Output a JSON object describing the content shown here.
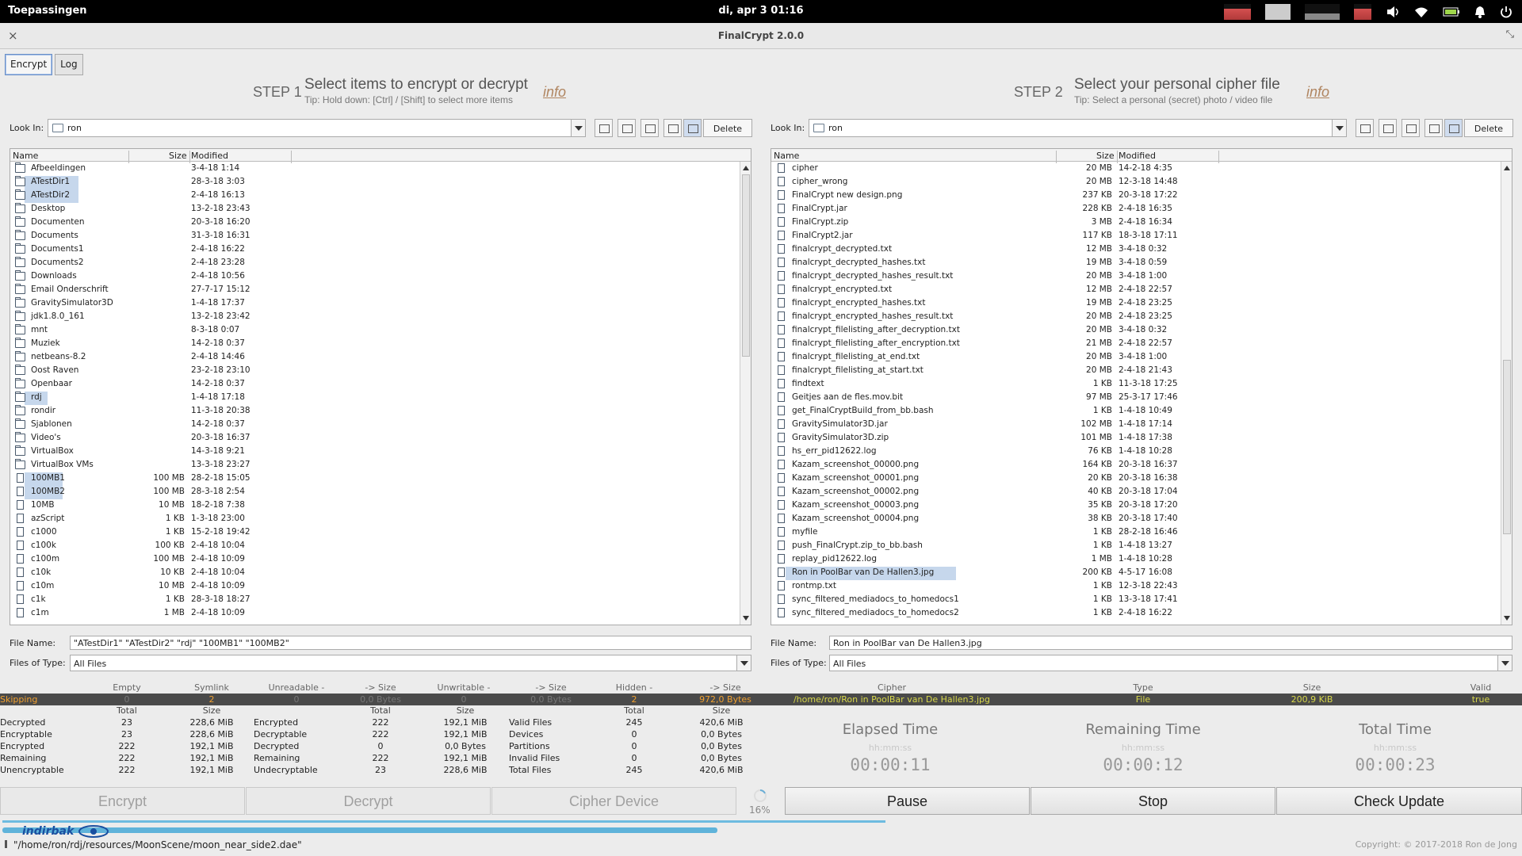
{
  "system_bar": {
    "apps_label": "Toepassingen",
    "clock": "di, apr  3    01:16"
  },
  "window": {
    "title": "FinalCrypt 2.0.0"
  },
  "tabs": [
    {
      "label": "Encrypt",
      "active": true
    },
    {
      "label": "Log",
      "active": false
    }
  ],
  "step1": {
    "num": "STEP 1",
    "heading": "Select items to encrypt or decrypt",
    "tip": "Tip: Hold down: [Ctrl] / [Shift] to select more items",
    "info": "info",
    "look_in_label": "Look In:",
    "look_in_value": "ron",
    "delete_label": "Delete",
    "columns": [
      "Name",
      "Size",
      "Modified"
    ],
    "rows": [
      {
        "name": "Afbeeldingen",
        "size": "",
        "modified": "3-4-18 1:14",
        "type": "folder",
        "selected": false
      },
      {
        "name": "ATestDir1",
        "size": "",
        "modified": "28-3-18 3:03",
        "type": "folder",
        "selected": true
      },
      {
        "name": "ATestDir2",
        "size": "",
        "modified": "2-4-18 16:13",
        "type": "folder",
        "selected": true
      },
      {
        "name": "Desktop",
        "size": "",
        "modified": "13-2-18 23:43",
        "type": "folder",
        "selected": false
      },
      {
        "name": "Documenten",
        "size": "",
        "modified": "20-3-18 16:20",
        "type": "folder",
        "selected": false
      },
      {
        "name": "Documents",
        "size": "",
        "modified": "31-3-18 16:31",
        "type": "folder",
        "selected": false
      },
      {
        "name": "Documents1",
        "size": "",
        "modified": "2-4-18 16:22",
        "type": "folder",
        "selected": false
      },
      {
        "name": "Documents2",
        "size": "",
        "modified": "2-4-18 23:28",
        "type": "folder",
        "selected": false
      },
      {
        "name": "Downloads",
        "size": "",
        "modified": "2-4-18 10:56",
        "type": "folder",
        "selected": false
      },
      {
        "name": "Email Onderschrift",
        "size": "",
        "modified": "27-7-17 15:12",
        "type": "folder",
        "selected": false
      },
      {
        "name": "GravitySimulator3D",
        "size": "",
        "modified": "1-4-18 17:37",
        "type": "folder",
        "selected": false
      },
      {
        "name": "jdk1.8.0_161",
        "size": "",
        "modified": "13-2-18 23:42",
        "type": "folder",
        "selected": false
      },
      {
        "name": "mnt",
        "size": "",
        "modified": "8-3-18 0:07",
        "type": "folder",
        "selected": false
      },
      {
        "name": "Muziek",
        "size": "",
        "modified": "14-2-18 0:37",
        "type": "folder",
        "selected": false
      },
      {
        "name": "netbeans-8.2",
        "size": "",
        "modified": "2-4-18 14:46",
        "type": "folder",
        "selected": false
      },
      {
        "name": "Oost Raven",
        "size": "",
        "modified": "23-2-18 23:10",
        "type": "folder",
        "selected": false
      },
      {
        "name": "Openbaar",
        "size": "",
        "modified": "14-2-18 0:37",
        "type": "folder",
        "selected": false
      },
      {
        "name": "rdj",
        "size": "",
        "modified": "1-4-18 17:18",
        "type": "folder",
        "selected": true
      },
      {
        "name": "rondir",
        "size": "",
        "modified": "11-3-18 20:38",
        "type": "folder",
        "selected": false
      },
      {
        "name": "Sjablonen",
        "size": "",
        "modified": "14-2-18 0:37",
        "type": "folder",
        "selected": false
      },
      {
        "name": "Video's",
        "size": "",
        "modified": "20-3-18 16:37",
        "type": "folder",
        "selected": false
      },
      {
        "name": "VirtualBox",
        "size": "",
        "modified": "14-3-18 9:21",
        "type": "folder",
        "selected": false
      },
      {
        "name": "VirtualBox VMs",
        "size": "",
        "modified": "13-3-18 23:27",
        "type": "folder",
        "selected": false
      },
      {
        "name": "100MB1",
        "size": "100 MB",
        "modified": "28-2-18 15:05",
        "type": "file",
        "selected": true
      },
      {
        "name": "100MB2",
        "size": "100 MB",
        "modified": "28-3-18 2:54",
        "type": "file",
        "selected": true
      },
      {
        "name": "10MB",
        "size": "10 MB",
        "modified": "18-2-18 7:38",
        "type": "file",
        "selected": false
      },
      {
        "name": "azScript",
        "size": "1 KB",
        "modified": "1-3-18 23:00",
        "type": "file",
        "selected": false
      },
      {
        "name": "c1000",
        "size": "1 KB",
        "modified": "15-2-18 19:42",
        "type": "file",
        "selected": false
      },
      {
        "name": "c100k",
        "size": "100 KB",
        "modified": "2-4-18 10:04",
        "type": "file",
        "selected": false
      },
      {
        "name": "c100m",
        "size": "100 MB",
        "modified": "2-4-18 10:09",
        "type": "file",
        "selected": false
      },
      {
        "name": "c10k",
        "size": "10 KB",
        "modified": "2-4-18 10:04",
        "type": "file",
        "selected": false
      },
      {
        "name": "c10m",
        "size": "10 MB",
        "modified": "2-4-18 10:09",
        "type": "file",
        "selected": false
      },
      {
        "name": "c1k",
        "size": "1 KB",
        "modified": "28-3-18 18:27",
        "type": "file",
        "selected": false
      },
      {
        "name": "c1m",
        "size": "1 MB",
        "modified": "2-4-18 10:09",
        "type": "file",
        "selected": false
      }
    ],
    "file_name_label": "File Name:",
    "file_name_value": "\"ATestDir1\" \"ATestDir2\" \"rdj\" \"100MB1\" \"100MB2\"",
    "files_of_type_label": "Files of Type:",
    "files_of_type_value": "All Files"
  },
  "step2": {
    "num": "STEP 2",
    "heading": "Select your personal cipher file",
    "tip": "Tip: Select a personal (secret) photo / video file",
    "info": "info",
    "look_in_label": "Look In:",
    "look_in_value": "ron",
    "delete_label": "Delete",
    "columns": [
      "Name",
      "Size",
      "Modified"
    ],
    "rows": [
      {
        "name": "cipher",
        "size": "20 MB",
        "modified": "14-2-18 4:35",
        "selected": false
      },
      {
        "name": "cipher_wrong",
        "size": "20 MB",
        "modified": "12-3-18 14:48",
        "selected": false
      },
      {
        "name": "FinalCrypt new design.png",
        "size": "237 KB",
        "modified": "20-3-18 17:22",
        "selected": false
      },
      {
        "name": "FinalCrypt.jar",
        "size": "228 KB",
        "modified": "2-4-18 16:35",
        "selected": false
      },
      {
        "name": "FinalCrypt.zip",
        "size": "3 MB",
        "modified": "2-4-18 16:34",
        "selected": false
      },
      {
        "name": "FinalCrypt2.jar",
        "size": "117 KB",
        "modified": "18-3-18 17:11",
        "selected": false
      },
      {
        "name": "finalcrypt_decrypted.txt",
        "size": "12 MB",
        "modified": "3-4-18 0:32",
        "selected": false
      },
      {
        "name": "finalcrypt_decrypted_hashes.txt",
        "size": "19 MB",
        "modified": "3-4-18 0:59",
        "selected": false
      },
      {
        "name": "finalcrypt_decrypted_hashes_result.txt",
        "size": "20 MB",
        "modified": "3-4-18 1:00",
        "selected": false
      },
      {
        "name": "finalcrypt_encrypted.txt",
        "size": "12 MB",
        "modified": "2-4-18 22:57",
        "selected": false
      },
      {
        "name": "finalcrypt_encrypted_hashes.txt",
        "size": "19 MB",
        "modified": "2-4-18 23:25",
        "selected": false
      },
      {
        "name": "finalcrypt_encrypted_hashes_result.txt",
        "size": "20 MB",
        "modified": "2-4-18 23:25",
        "selected": false
      },
      {
        "name": "finalcrypt_filelisting_after_decryption.txt",
        "size": "20 MB",
        "modified": "3-4-18 0:32",
        "selected": false
      },
      {
        "name": "finalcrypt_filelisting_after_encryption.txt",
        "size": "21 MB",
        "modified": "2-4-18 22:57",
        "selected": false
      },
      {
        "name": "finalcrypt_filelisting_at_end.txt",
        "size": "20 MB",
        "modified": "3-4-18 1:00",
        "selected": false
      },
      {
        "name": "finalcrypt_filelisting_at_start.txt",
        "size": "20 MB",
        "modified": "2-4-18 21:43",
        "selected": false
      },
      {
        "name": "findtext",
        "size": "1 KB",
        "modified": "11-3-18 17:25",
        "selected": false
      },
      {
        "name": "Geitjes aan de fles.mov.bit",
        "size": "97 MB",
        "modified": "25-3-17 17:46",
        "selected": false
      },
      {
        "name": "get_FinalCryptBuild_from_bb.bash",
        "size": "1 KB",
        "modified": "1-4-18 10:49",
        "selected": false
      },
      {
        "name": "GravitySimulator3D.jar",
        "size": "102 MB",
        "modified": "1-4-18 17:14",
        "selected": false
      },
      {
        "name": "GravitySimulator3D.zip",
        "size": "101 MB",
        "modified": "1-4-18 17:38",
        "selected": false
      },
      {
        "name": "hs_err_pid12622.log",
        "size": "76 KB",
        "modified": "1-4-18 10:28",
        "selected": false
      },
      {
        "name": "Kazam_screenshot_00000.png",
        "size": "164 KB",
        "modified": "20-3-18 16:37",
        "selected": false
      },
      {
        "name": "Kazam_screenshot_00001.png",
        "size": "20 KB",
        "modified": "20-3-18 16:38",
        "selected": false
      },
      {
        "name": "Kazam_screenshot_00002.png",
        "size": "40 KB",
        "modified": "20-3-18 17:04",
        "selected": false
      },
      {
        "name": "Kazam_screenshot_00003.png",
        "size": "35 KB",
        "modified": "20-3-18 17:20",
        "selected": false
      },
      {
        "name": "Kazam_screenshot_00004.png",
        "size": "38 KB",
        "modified": "20-3-18 17:40",
        "selected": false
      },
      {
        "name": "myfile",
        "size": "1 KB",
        "modified": "28-2-18 16:46",
        "selected": false
      },
      {
        "name": "push_FinalCrypt.zip_to_bb.bash",
        "size": "1 KB",
        "modified": "1-4-18 13:27",
        "selected": false
      },
      {
        "name": "replay_pid12622.log",
        "size": "1 MB",
        "modified": "1-4-18 10:28",
        "selected": false
      },
      {
        "name": "Ron in PoolBar van De Hallen3.jpg",
        "size": "200 KB",
        "modified": "4-5-17 16:08",
        "selected": true
      },
      {
        "name": "rontmp.txt",
        "size": "1 KB",
        "modified": "12-3-18 22:43",
        "selected": false
      },
      {
        "name": "sync_filtered_mediadocs_to_homedocs1",
        "size": "1 KB",
        "modified": "13-3-18 17:41",
        "selected": false
      },
      {
        "name": "sync_filtered_mediadocs_to_homedocs2",
        "size": "1 KB",
        "modified": "2-4-18 16:22",
        "selected": false
      }
    ],
    "file_name_label": "File Name:",
    "file_name_value": "Ron in PoolBar van De Hallen3.jpg",
    "files_of_type_label": "Files of Type:",
    "files_of_type_value": "All Files"
  },
  "skip_headers": [
    "Empty",
    "Symlink",
    "Unreadable -",
    "-> Size",
    "Unwritable -",
    "-> Size",
    "Hidden -",
    "-> Size"
  ],
  "cipher_headers": [
    "Cipher",
    "Type",
    "Size",
    "Valid"
  ],
  "skipping_row": {
    "label": "Skipping",
    "values": [
      "0",
      "2",
      "0",
      "0,0 Bytes",
      "0",
      "0,0 Bytes",
      "2",
      "972,0 Bytes"
    ],
    "cipher_path": "/home/ron/Ron in PoolBar van De Hallen3.jpg",
    "cipher_type": "File",
    "cipher_size": "200,9 KiB",
    "cipher_valid": "true"
  },
  "stats": {
    "col_total": "Total",
    "col_size": "Size",
    "group1": [
      {
        "label": "Decrypted",
        "total": "23",
        "size": "228,6 MiB"
      },
      {
        "label": "Encryptable",
        "total": "23",
        "size": "228,6 MiB"
      },
      {
        "label": "Encrypted",
        "total": "222",
        "size": "192,1 MiB"
      },
      {
        "label": "Remaining",
        "total": "222",
        "size": "192,1 MiB"
      },
      {
        "label": "Unencryptable",
        "total": "222",
        "size": "192,1 MiB"
      }
    ],
    "group2": [
      {
        "label": "Encrypted",
        "total": "222",
        "size": "192,1 MiB"
      },
      {
        "label": "Decryptable",
        "total": "222",
        "size": "192,1 MiB"
      },
      {
        "label": "Decrypted",
        "total": "0",
        "size": "0,0 Bytes"
      },
      {
        "label": "Remaining",
        "total": "222",
        "size": "192,1 MiB"
      },
      {
        "label": "Undecryptable",
        "total": "23",
        "size": "228,6 MiB"
      }
    ],
    "group3": [
      {
        "label": "Valid Files",
        "total": "245",
        "size": "420,6 MiB"
      },
      {
        "label": "Devices",
        "total": "0",
        "size": "0,0 Bytes"
      },
      {
        "label": "Partitions",
        "total": "0",
        "size": "0,0 Bytes"
      },
      {
        "label": "Invalid Files",
        "total": "0",
        "size": "0,0 Bytes"
      },
      {
        "label": "Total Files",
        "total": "245",
        "size": "420,6 MiB"
      }
    ]
  },
  "timers": [
    {
      "label": "Elapsed Time",
      "format": "hh:mm:ss",
      "value": "00:00:11"
    },
    {
      "label": "Remaining Time",
      "format": "hh:mm:ss",
      "value": "00:00:12"
    },
    {
      "label": "Total Time",
      "format": "hh:mm:ss",
      "value": "00:00:23"
    }
  ],
  "buttons": {
    "encrypt": "Encrypt",
    "decrypt": "Decrypt",
    "cipher_device": "Cipher Device",
    "progress_percent": "16%",
    "pause": "Pause",
    "stop": "Stop",
    "check_update": "Check Update"
  },
  "progress": {
    "file_progress": 0.47,
    "total_progress": 0.58
  },
  "watermark": "indirbak",
  "status": {
    "path": "\"/home/ron/rdj/resources/MoonScene/moon_near_side2.dae\"",
    "copyright": "Copyright: © 2017-2018 Ron de Jong"
  }
}
